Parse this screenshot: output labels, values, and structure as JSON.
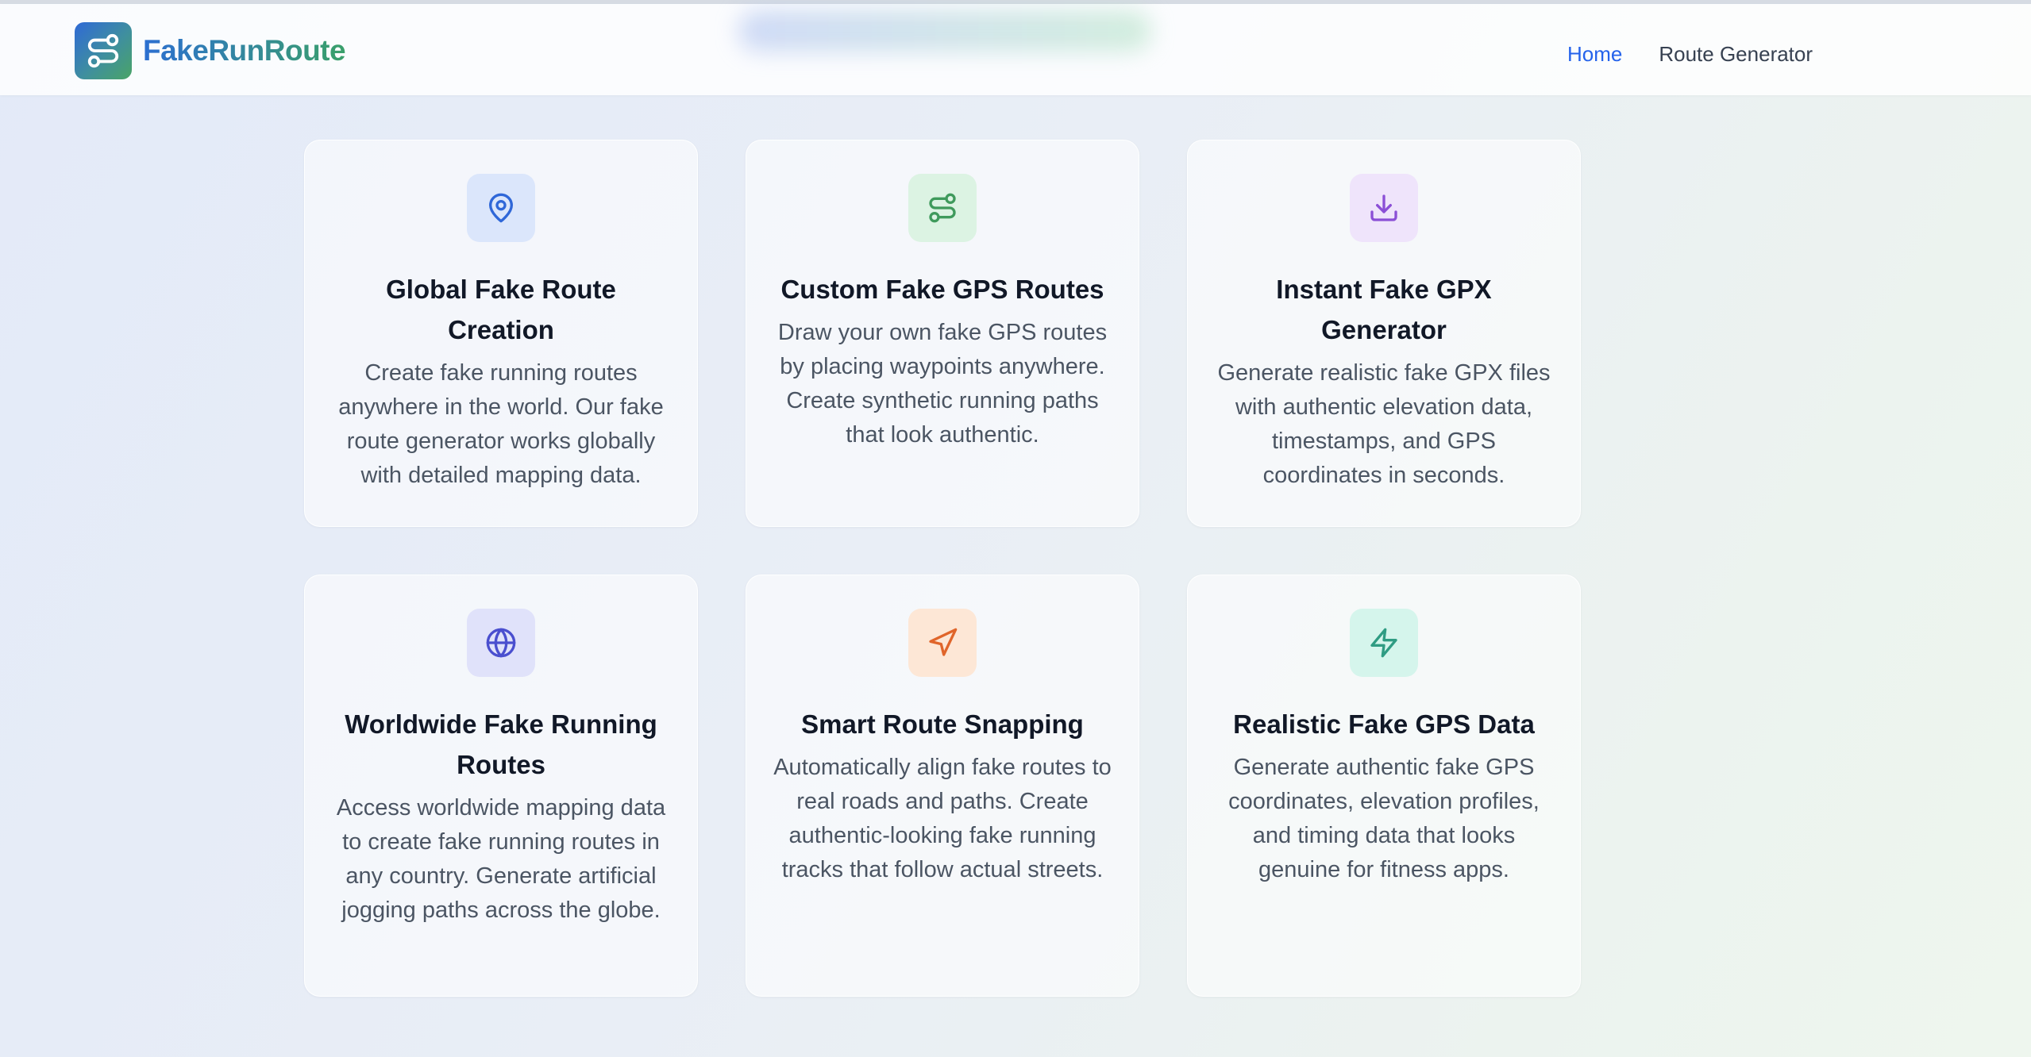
{
  "header": {
    "brand_name": "FakeRunRoute",
    "logo_icon": "route-icon",
    "nav": [
      {
        "label": "Home",
        "active": true
      },
      {
        "label": "Route Generator",
        "active": false
      }
    ]
  },
  "colors": {
    "accent": "#2563eb",
    "brand_gradient_start": "#2f69d6",
    "brand_gradient_end": "#4aa466"
  },
  "features": [
    {
      "icon": "map-pin-icon",
      "icon_color": "#2f67d8",
      "icon_bg": "#dbe6fb",
      "title": "Global Fake Route Creation",
      "description": "Create fake running routes anywhere in the world. Our fake route generator works globally with detailed mapping data."
    },
    {
      "icon": "route-icon",
      "icon_color": "#3f9a5c",
      "icon_bg": "#dcf3e3",
      "title": "Custom Fake GPS Routes",
      "description": "Draw your own fake GPS routes by placing waypoints anywhere. Create synthetic running paths that look authentic."
    },
    {
      "icon": "download-icon",
      "icon_color": "#8b4fd6",
      "icon_bg": "#efe4fb",
      "title": "Instant Fake GPX Generator",
      "description": "Generate realistic fake GPX files with authentic elevation data, timestamps, and GPS coordinates in seconds."
    },
    {
      "icon": "globe-icon",
      "icon_color": "#4a4fcf",
      "icon_bg": "#e0e2fa",
      "title": "Worldwide Fake Running Routes",
      "description": "Access worldwide mapping data to create fake running routes in any country. Generate artificial jogging paths across the globe."
    },
    {
      "icon": "navigation-icon",
      "icon_color": "#e0652a",
      "icon_bg": "#fde7d6",
      "title": "Smart Route Snapping",
      "description": "Automatically align fake routes to real roads and paths. Create authentic-looking fake running tracks that follow actual streets."
    },
    {
      "icon": "lightning-icon",
      "icon_color": "#2f9c83",
      "icon_bg": "#d5f5ec",
      "title": "Realistic Fake GPS Data",
      "description": "Generate authentic fake GPS coordinates, elevation profiles, and timing data that looks genuine for fitness apps."
    }
  ]
}
